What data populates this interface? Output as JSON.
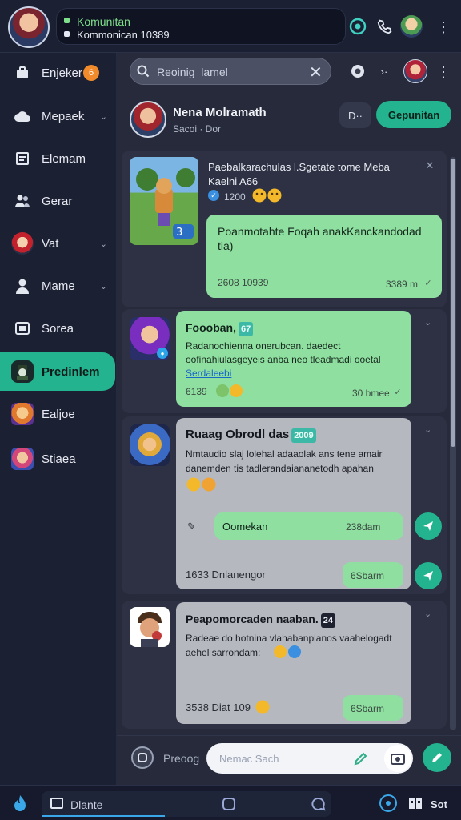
{
  "top": {
    "title": "Komunitan",
    "subtitle": "Kommonican 10389"
  },
  "sidebar": {
    "items": [
      {
        "label": "Enjeker",
        "icon": "bag-icon",
        "badge": "6"
      },
      {
        "label": "Mepaek",
        "icon": "cloud-icon",
        "chevron": "⌄"
      },
      {
        "label": "Elemam",
        "icon": "document-icon"
      },
      {
        "label": "Gerar",
        "icon": "people-icon"
      },
      {
        "label": "Vat",
        "icon": "game-avatar-icon",
        "chevron": "⌄"
      },
      {
        "label": "Mame",
        "icon": "person-icon",
        "chevron": "⌄"
      },
      {
        "label": "Sorea",
        "icon": "screen-icon"
      },
      {
        "label": "Predinlem",
        "icon": "character-icon",
        "active": true
      },
      {
        "label": "Ealjoe",
        "icon": "hero-icon"
      },
      {
        "label": "Stiaea",
        "icon": "character-icon"
      }
    ]
  },
  "search": {
    "placeholder": "Reoinig  lamel"
  },
  "contact": {
    "name": "Nena Molramath",
    "status": "Sacoi · Dor"
  },
  "header_buttons": {
    "secondary": "D·· ",
    "primary": "Gepunitan"
  },
  "cards": [
    {
      "text": "Paebalkarachulas l.Sgetate tome Meba Kaelni A66",
      "meta": "1200",
      "reply_text": "Poanmotahte Foqah anakKanckandodad tia)",
      "reply_time": "2608 10939",
      "reply_ts": "3389 m"
    },
    {
      "sender": "Foooban,",
      "sender_tag": "67",
      "text": "Radanochienna onerubcan. daedect oofinahiulasgeyeis anba neo tleadmadi ooetal",
      "link": "Serdaleebi",
      "meta": "6139",
      "time": "30 bmee"
    },
    {
      "sender": "Ruaag Obrodl das",
      "sender_tag": "2009",
      "text": "Nmtaudio slaj lolehal adaaolak ans tene amair danemden tis tadlerandaiananetodh apahan",
      "reply": "Oomekan",
      "reply_time": "238dam",
      "meta": "1633 Dnlanengor",
      "time2": "6Sbarm"
    },
    {
      "sender": "Peapomorcaden naaban.",
      "sender_tag": "24",
      "text": "Radeae do hotnina vlahabanplanos vaahelogadt aehel sarrondam:",
      "meta": "3538 Diat 109",
      "time": "6Sbarm"
    }
  ],
  "composer": {
    "label": "Preoog",
    "placeholder": "Nemac Sach"
  },
  "bottom": {
    "label": "Dlante",
    "right_label": "Sot"
  },
  "colors": {
    "accent": "#23b48f",
    "bubble_green": "#8fdfa0",
    "bubble_gray": "#b6b8c0",
    "background": "#262a3a"
  }
}
